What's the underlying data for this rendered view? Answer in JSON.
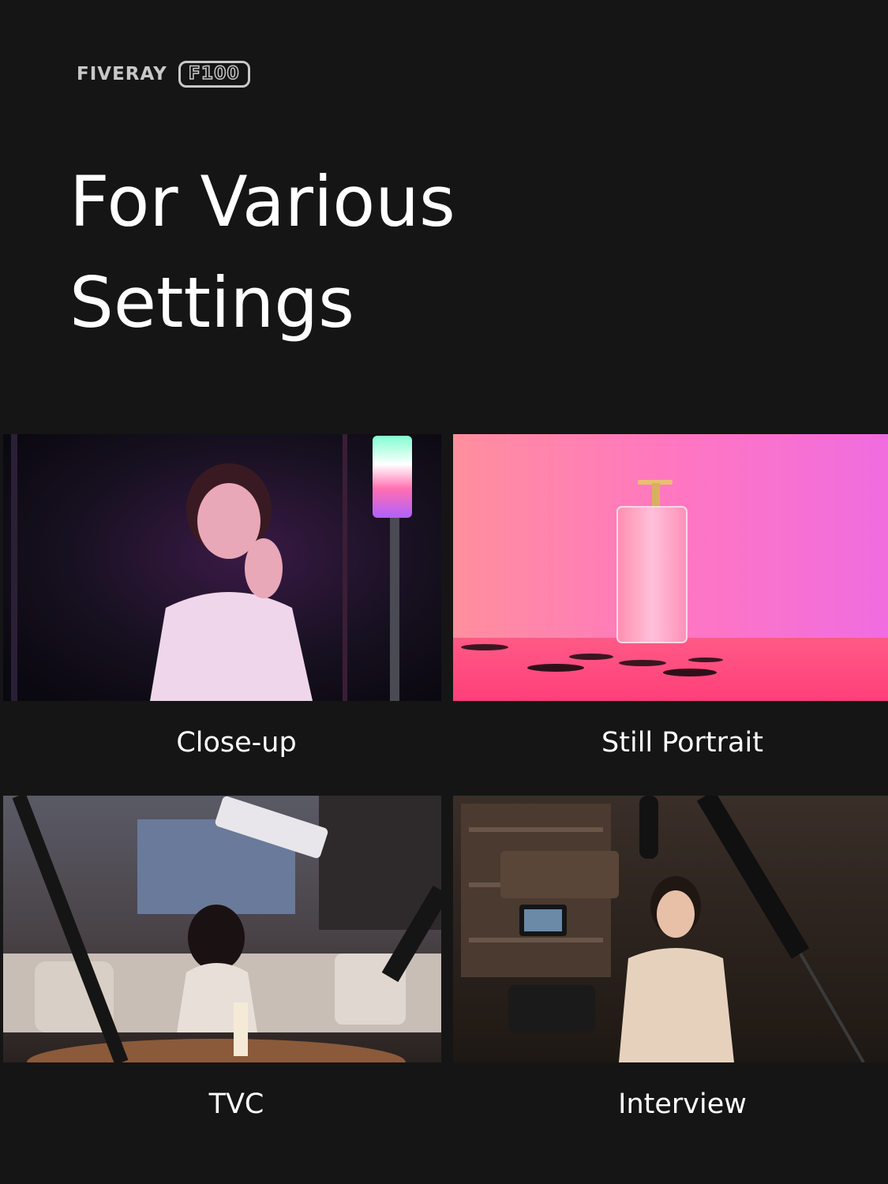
{
  "brand": {
    "name": "FIVERAY",
    "model": "F100"
  },
  "headline": {
    "line1": "For Various",
    "line2": "Settings"
  },
  "scenes": [
    {
      "label": "Close-up"
    },
    {
      "label": "Still Portrait"
    },
    {
      "label": "TVC"
    },
    {
      "label": "Interview"
    }
  ],
  "colors": {
    "background": "#151515",
    "text": "#ffffff",
    "logo": "#c8c8c8"
  }
}
